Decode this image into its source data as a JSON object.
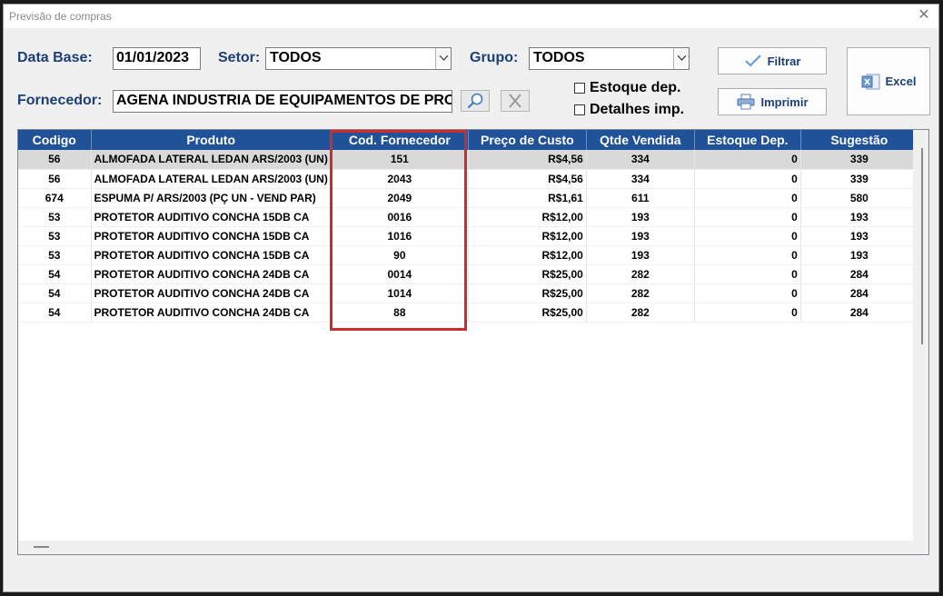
{
  "window": {
    "title": "Previsão de compras",
    "close_label": "✕"
  },
  "filters": {
    "data_base_label": "Data Base:",
    "data_base_value": "01/01/2023",
    "setor_label": "Setor:",
    "setor_value": "TODOS",
    "grupo_label": "Grupo:",
    "grupo_value": "TODOS",
    "fornecedor_label": "Fornecedor:",
    "fornecedor_value": "AGENA INDUSTRIA DE EQUIPAMENTOS DE PROTEÇÃO",
    "estoque_dep_label": "Estoque dep.",
    "detalhes_imp_label": "Detalhes imp."
  },
  "buttons": {
    "filtrar": "Filtrar",
    "imprimir": "Imprimir",
    "excel": "Excel"
  },
  "table": {
    "columns": [
      "Codigo",
      "Produto",
      "Cod. Fornecedor",
      "Preço de Custo",
      "Qtde Vendida",
      "Estoque Dep.",
      "Sugestão"
    ],
    "rows": [
      [
        "56",
        "ALMOFADA LATERAL LEDAN ARS/2003 (UN)",
        "151",
        "R$4,56",
        "334",
        "0",
        "339"
      ],
      [
        "56",
        "ALMOFADA LATERAL LEDAN ARS/2003 (UN)",
        "2043",
        "R$4,56",
        "334",
        "0",
        "339"
      ],
      [
        "674",
        "ESPUMA P/ ARS/2003 (PÇ UN - VEND PAR)",
        "2049",
        "R$1,61",
        "611",
        "0",
        "580"
      ],
      [
        "53",
        "PROTETOR AUDITIVO CONCHA 15DB CA",
        "0016",
        "R$12,00",
        "193",
        "0",
        "193"
      ],
      [
        "53",
        "PROTETOR AUDITIVO CONCHA 15DB CA",
        "1016",
        "R$12,00",
        "193",
        "0",
        "193"
      ],
      [
        "53",
        "PROTETOR AUDITIVO CONCHA 15DB CA",
        "90",
        "R$12,00",
        "193",
        "0",
        "193"
      ],
      [
        "54",
        "PROTETOR AUDITIVO CONCHA 24DB CA",
        "0014",
        "R$25,00",
        "282",
        "0",
        "284"
      ],
      [
        "54",
        "PROTETOR AUDITIVO CONCHA 24DB CA",
        "1014",
        "R$25,00",
        "282",
        "0",
        "284"
      ],
      [
        "54",
        "PROTETOR AUDITIVO CONCHA 24DB CA",
        "88",
        "R$25,00",
        "282",
        "0",
        "284"
      ]
    ],
    "selected_row": 0
  },
  "colors": {
    "header_bg": "#1f5298",
    "label": "#1c3f77",
    "highlight": "#d02b2b"
  }
}
